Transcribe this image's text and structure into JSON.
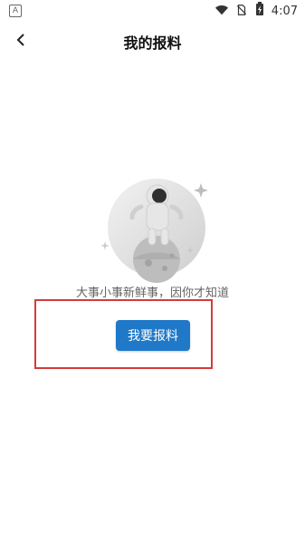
{
  "status_bar": {
    "time": "4:07",
    "left_icon": "a-icon",
    "right_icons": [
      "wifi-icon",
      "no-sim-icon",
      "battery-charging-icon"
    ]
  },
  "header": {
    "title": "我的报料",
    "back_icon": "chevron-left-icon"
  },
  "empty_state": {
    "illustration": "astronaut-on-planet-illustration",
    "message": "大事小事新鲜事，因你才知道"
  },
  "actions": {
    "report_button_label": "我要报料"
  },
  "colors": {
    "primary_button": "#1f79c8",
    "highlight_border": "#d43b3b"
  }
}
